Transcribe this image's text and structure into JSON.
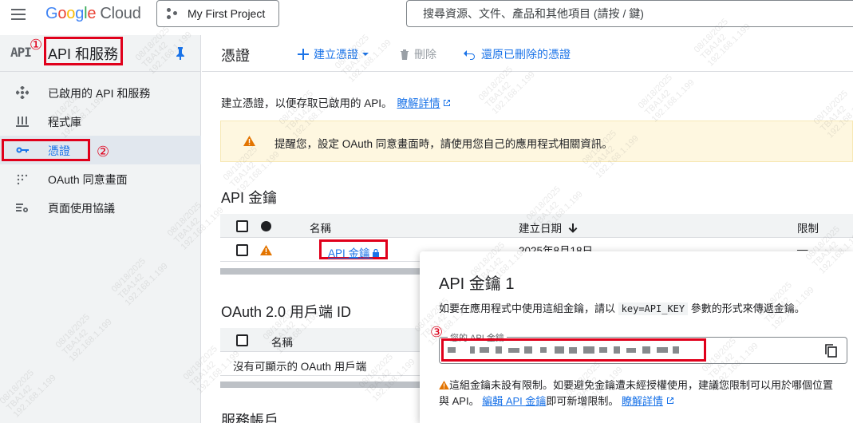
{
  "topbar": {
    "product_logo_google": "Google",
    "product_logo_cloud": "Cloud",
    "project_name": "My First Project",
    "search_placeholder": "搜尋資源、文件、產品和其他項目 (請按 / 鍵)"
  },
  "sidebar": {
    "logo_text": "API",
    "title": "API 和服務",
    "items": [
      {
        "label": "已啟用的 API 和服務",
        "icon": "api-dots-icon"
      },
      {
        "label": "程式庫",
        "icon": "library-icon"
      },
      {
        "label": "憑證",
        "icon": "key-icon",
        "active": true
      },
      {
        "label": "OAuth 同意畫面",
        "icon": "consent-icon"
      },
      {
        "label": "頁面使用協議",
        "icon": "settings-list-icon"
      }
    ]
  },
  "page": {
    "title": "憑證",
    "toolbar": {
      "create_label": "建立憑證",
      "delete_label": "刪除",
      "restore_label": "還原已刪除的憑證"
    },
    "intro_text": "建立憑證，以便存取已啟用的 API。",
    "intro_link": "瞭解詳情",
    "warning_text": "提醒您，設定 OAuth 同意畫面時，請使用您自己的應用程式相關資訊。"
  },
  "api_keys": {
    "section_title": "API 金鑰",
    "columns": [
      "名稱",
      "建立日期",
      "限制"
    ],
    "rows": [
      {
        "name": "API 金鑰",
        "created": "2025年8月18日",
        "restriction": "—"
      }
    ]
  },
  "oauth": {
    "section_title": "OAuth 2.0 用戶端 ID",
    "columns": [
      "名稱"
    ],
    "empty_text": "沒有可顯示的 OAuth 用戶端"
  },
  "service_accounts": {
    "section_title": "服務帳戶"
  },
  "dialog": {
    "title": "API 金鑰 1",
    "desc_prefix": "如要在應用程式中使用這組金鑰，請以",
    "desc_code": "key=API_KEY",
    "desc_suffix": "參數的形式來傳遞金鑰。",
    "field_label": "您的 API 金鑰",
    "warn_text": "這組金鑰未設有限制。如要避免金鑰遭未經授權使用，建議您限制可以用於哪個位置與 API。",
    "edit_link": "編輯 API 金鑰",
    "edit_suffix": "即可新增限制。",
    "learn_link": "瞭解詳情"
  },
  "annotations": [
    "①",
    "②",
    "③"
  ],
  "watermark_lines": [
    "08/18/2025",
    "TBA142",
    "192.168.1.199"
  ],
  "colors": {
    "accent": "#1a73e8",
    "annotation_red": "#e0001b",
    "warning": "#e37400"
  }
}
